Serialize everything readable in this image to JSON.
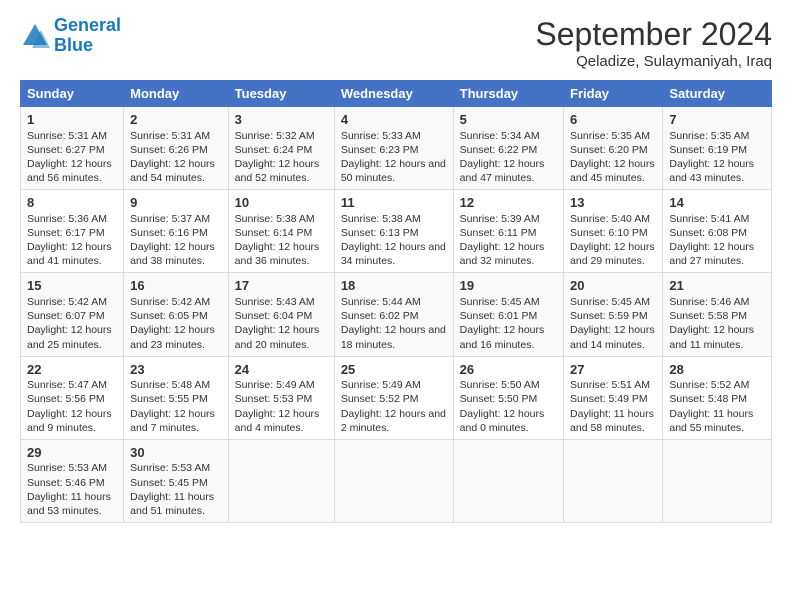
{
  "header": {
    "logo_line1": "General",
    "logo_line2": "Blue",
    "title": "September 2024",
    "subtitle": "Qeladize, Sulaymaniyah, Iraq"
  },
  "days": [
    "Sunday",
    "Monday",
    "Tuesday",
    "Wednesday",
    "Thursday",
    "Friday",
    "Saturday"
  ],
  "weeks": [
    [
      {
        "day": "1",
        "sunrise": "5:31 AM",
        "sunset": "6:27 PM",
        "daylight": "12 hours and 56 minutes."
      },
      {
        "day": "2",
        "sunrise": "5:31 AM",
        "sunset": "6:26 PM",
        "daylight": "12 hours and 54 minutes."
      },
      {
        "day": "3",
        "sunrise": "5:32 AM",
        "sunset": "6:24 PM",
        "daylight": "12 hours and 52 minutes."
      },
      {
        "day": "4",
        "sunrise": "5:33 AM",
        "sunset": "6:23 PM",
        "daylight": "12 hours and 50 minutes."
      },
      {
        "day": "5",
        "sunrise": "5:34 AM",
        "sunset": "6:22 PM",
        "daylight": "12 hours and 47 minutes."
      },
      {
        "day": "6",
        "sunrise": "5:35 AM",
        "sunset": "6:20 PM",
        "daylight": "12 hours and 45 minutes."
      },
      {
        "day": "7",
        "sunrise": "5:35 AM",
        "sunset": "6:19 PM",
        "daylight": "12 hours and 43 minutes."
      }
    ],
    [
      {
        "day": "8",
        "sunrise": "5:36 AM",
        "sunset": "6:17 PM",
        "daylight": "12 hours and 41 minutes."
      },
      {
        "day": "9",
        "sunrise": "5:37 AM",
        "sunset": "6:16 PM",
        "daylight": "12 hours and 38 minutes."
      },
      {
        "day": "10",
        "sunrise": "5:38 AM",
        "sunset": "6:14 PM",
        "daylight": "12 hours and 36 minutes."
      },
      {
        "day": "11",
        "sunrise": "5:38 AM",
        "sunset": "6:13 PM",
        "daylight": "12 hours and 34 minutes."
      },
      {
        "day": "12",
        "sunrise": "5:39 AM",
        "sunset": "6:11 PM",
        "daylight": "12 hours and 32 minutes."
      },
      {
        "day": "13",
        "sunrise": "5:40 AM",
        "sunset": "6:10 PM",
        "daylight": "12 hours and 29 minutes."
      },
      {
        "day": "14",
        "sunrise": "5:41 AM",
        "sunset": "6:08 PM",
        "daylight": "12 hours and 27 minutes."
      }
    ],
    [
      {
        "day": "15",
        "sunrise": "5:42 AM",
        "sunset": "6:07 PM",
        "daylight": "12 hours and 25 minutes."
      },
      {
        "day": "16",
        "sunrise": "5:42 AM",
        "sunset": "6:05 PM",
        "daylight": "12 hours and 23 minutes."
      },
      {
        "day": "17",
        "sunrise": "5:43 AM",
        "sunset": "6:04 PM",
        "daylight": "12 hours and 20 minutes."
      },
      {
        "day": "18",
        "sunrise": "5:44 AM",
        "sunset": "6:02 PM",
        "daylight": "12 hours and 18 minutes."
      },
      {
        "day": "19",
        "sunrise": "5:45 AM",
        "sunset": "6:01 PM",
        "daylight": "12 hours and 16 minutes."
      },
      {
        "day": "20",
        "sunrise": "5:45 AM",
        "sunset": "5:59 PM",
        "daylight": "12 hours and 14 minutes."
      },
      {
        "day": "21",
        "sunrise": "5:46 AM",
        "sunset": "5:58 PM",
        "daylight": "12 hours and 11 minutes."
      }
    ],
    [
      {
        "day": "22",
        "sunrise": "5:47 AM",
        "sunset": "5:56 PM",
        "daylight": "12 hours and 9 minutes."
      },
      {
        "day": "23",
        "sunrise": "5:48 AM",
        "sunset": "5:55 PM",
        "daylight": "12 hours and 7 minutes."
      },
      {
        "day": "24",
        "sunrise": "5:49 AM",
        "sunset": "5:53 PM",
        "daylight": "12 hours and 4 minutes."
      },
      {
        "day": "25",
        "sunrise": "5:49 AM",
        "sunset": "5:52 PM",
        "daylight": "12 hours and 2 minutes."
      },
      {
        "day": "26",
        "sunrise": "5:50 AM",
        "sunset": "5:50 PM",
        "daylight": "12 hours and 0 minutes."
      },
      {
        "day": "27",
        "sunrise": "5:51 AM",
        "sunset": "5:49 PM",
        "daylight": "11 hours and 58 minutes."
      },
      {
        "day": "28",
        "sunrise": "5:52 AM",
        "sunset": "5:48 PM",
        "daylight": "11 hours and 55 minutes."
      }
    ],
    [
      {
        "day": "29",
        "sunrise": "5:53 AM",
        "sunset": "5:46 PM",
        "daylight": "11 hours and 53 minutes."
      },
      {
        "day": "30",
        "sunrise": "5:53 AM",
        "sunset": "5:45 PM",
        "daylight": "11 hours and 51 minutes."
      },
      null,
      null,
      null,
      null,
      null
    ]
  ]
}
